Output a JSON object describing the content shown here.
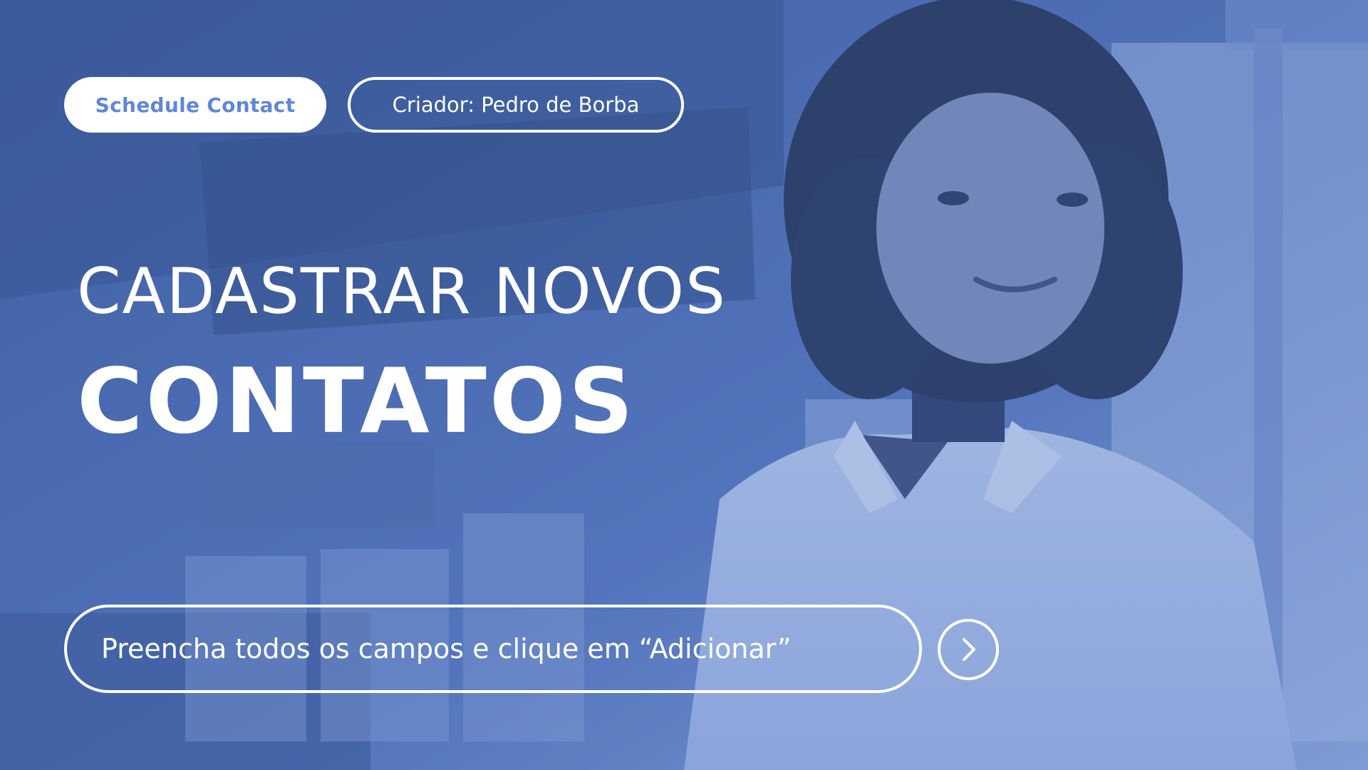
{
  "header": {
    "primary_button": "Schedule Contact",
    "creator_label": "Criador: Pedro de Borba"
  },
  "hero": {
    "title_line1": "CADASTRAR NOVOS",
    "title_line2": "CONTATOS"
  },
  "instruction": {
    "text": "Preencha todos os campos e clique em “Adicionar”"
  },
  "icons": {
    "next": "chevron-right-icon"
  },
  "colors": {
    "overlay": "#4a6cb3",
    "accent_text": "#5f87d8",
    "foreground": "#ffffff"
  }
}
